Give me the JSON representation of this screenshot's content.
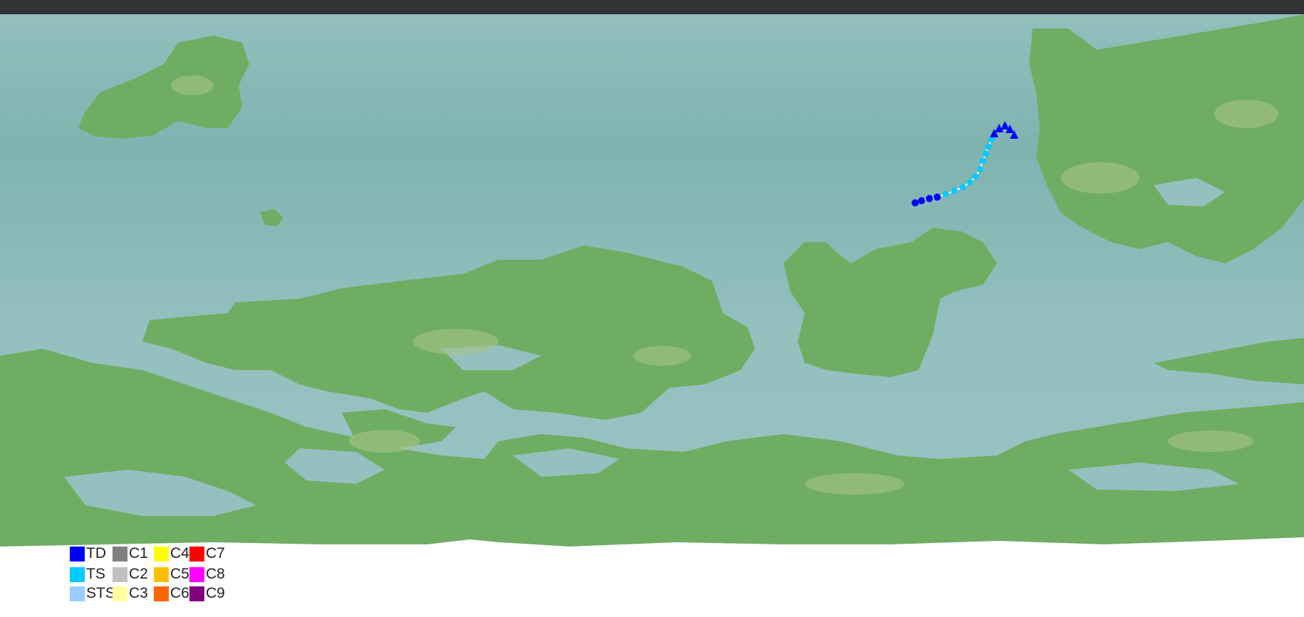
{
  "colors": {
    "ocean": "#95c0bf",
    "ocean_deep": "#7fb3b0",
    "land": "#6fad62",
    "land_light": "#8fbf79",
    "land_high": "#b9c895",
    "track_line": "#ffffff"
  },
  "track": {
    "points": [
      {
        "cat": "TD",
        "shape": "circle"
      },
      {
        "cat": "TD",
        "shape": "circle"
      },
      {
        "cat": "TD",
        "shape": "circle"
      },
      {
        "cat": "TD",
        "shape": "circle"
      },
      {
        "cat": "TS",
        "shape": "circle"
      },
      {
        "cat": "TS",
        "shape": "circle"
      },
      {
        "cat": "TS",
        "shape": "circle"
      },
      {
        "cat": "TS",
        "shape": "circle"
      },
      {
        "cat": "TS",
        "shape": "circle"
      },
      {
        "cat": "TS",
        "shape": "circle"
      },
      {
        "cat": "TS",
        "shape": "circle"
      },
      {
        "cat": "TS",
        "shape": "circle"
      },
      {
        "cat": "TS",
        "shape": "circle"
      },
      {
        "cat": "TS",
        "shape": "circle"
      },
      {
        "cat": "TD",
        "shape": "triangle"
      },
      {
        "cat": "TD",
        "shape": "triangle"
      },
      {
        "cat": "TD",
        "shape": "triangle"
      },
      {
        "cat": "TD",
        "shape": "triangle"
      },
      {
        "cat": "TD",
        "shape": "triangle"
      }
    ]
  },
  "legend": [
    {
      "label": "TD",
      "color": "#0000ff"
    },
    {
      "label": "TS",
      "color": "#00ccff"
    },
    {
      "label": "STS",
      "color": "#99ccff"
    },
    {
      "label": "C1",
      "color": "#808080"
    },
    {
      "label": "C2",
      "color": "#c0c0c0"
    },
    {
      "label": "C3",
      "color": "#ffffa0"
    },
    {
      "label": "C4",
      "color": "#ffff00"
    },
    {
      "label": "C5",
      "color": "#ffc000"
    },
    {
      "label": "C6",
      "color": "#ff6600"
    },
    {
      "label": "C7",
      "color": "#ff0000"
    },
    {
      "label": "C8",
      "color": "#ff00ff"
    },
    {
      "label": "C9",
      "color": "#800080"
    }
  ]
}
